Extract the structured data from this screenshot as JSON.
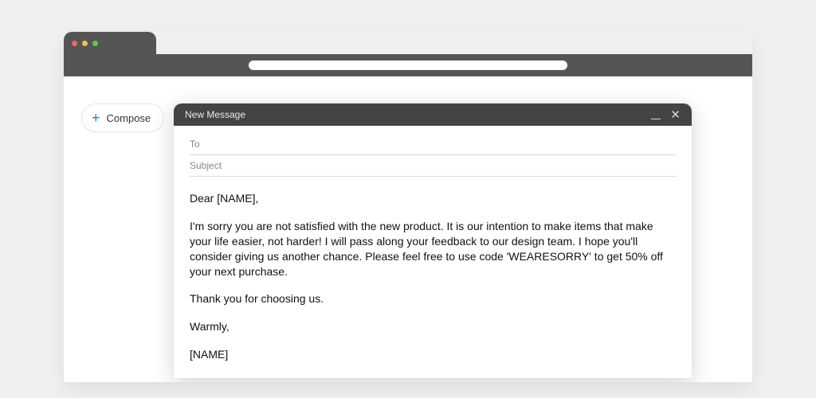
{
  "compose_button": {
    "label": "Compose"
  },
  "compose_window": {
    "title": "New Message",
    "to_label": "To",
    "subject_label": "Subject",
    "body": {
      "greeting": "Dear [NAME],",
      "para1": "I'm sorry you are not satisfied with the new product. It is our intention to make items that make your life easier, not harder! I will pass along your feedback to our design team. I hope you'll consider giving us another chance. Please feel free to use code 'WEARESORRY' to get 50% off your next purchase.",
      "para2": "Thank you for choosing us.",
      "signoff": "Warmly,",
      "sender": "[NAME]"
    }
  }
}
